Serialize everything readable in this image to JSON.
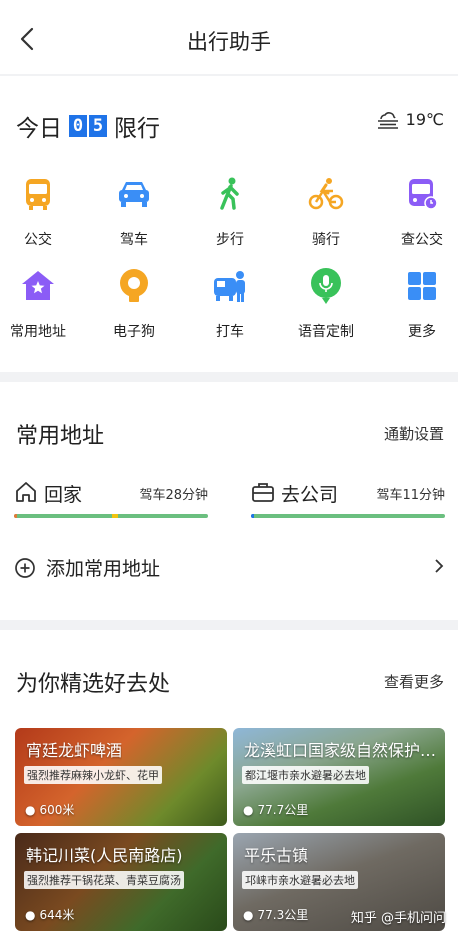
{
  "header": {
    "title": "出行助手"
  },
  "restriction": {
    "label_prefix": "今日",
    "digit1": "0",
    "digit2": "5",
    "label_suffix": "限行"
  },
  "weather": {
    "temp": "19℃",
    "icon": "cloud-fog-icon"
  },
  "grid": {
    "items": [
      {
        "label": "公交",
        "icon": "bus-icon",
        "color": "#f5a623"
      },
      {
        "label": "驾车",
        "icon": "car-icon",
        "color": "#3a8ef6"
      },
      {
        "label": "步行",
        "icon": "walk-icon",
        "color": "#39c25a"
      },
      {
        "label": "骑行",
        "icon": "bike-icon",
        "color": "#f5a623"
      },
      {
        "label": "查公交",
        "icon": "bus-search-icon",
        "color": "#8b5cf6"
      },
      {
        "label": "常用地址",
        "icon": "home-star-icon",
        "color": "#8b5cf6"
      },
      {
        "label": "电子狗",
        "icon": "edog-icon",
        "color": "#f5a623"
      },
      {
        "label": "打车",
        "icon": "taxi-icon",
        "color": "#3a8ef6"
      },
      {
        "label": "语音定制",
        "icon": "mic-icon",
        "color": "#39c25a"
      },
      {
        "label": "更多",
        "icon": "more-grid-icon",
        "color": "#3a8ef6"
      }
    ]
  },
  "addresses": {
    "title": "常用地址",
    "link": "通勤设置",
    "home": {
      "name": "回家",
      "duration": "驾车28分钟"
    },
    "work": {
      "name": "去公司",
      "duration": "驾车11分钟"
    },
    "add_label": "添加常用地址"
  },
  "recommend": {
    "title": "为你精选好去处",
    "link": "查看更多",
    "places": [
      {
        "name": "宵廷龙虾啤酒",
        "tag": "强烈推荐麻辣小龙虾、花甲",
        "distance": "600米"
      },
      {
        "name": "龙溪虹口国家级自然保护…",
        "tag": "都江堰市亲水避暑必去地",
        "distance": "77.7公里"
      },
      {
        "name": "韩记川菜(人民南路店)",
        "tag": "强烈推荐干锅花菜、青菜豆腐汤",
        "distance": "644米"
      },
      {
        "name": "平乐古镇",
        "tag": "邛崃市亲水避暑必去地",
        "distance": "77.3公里"
      }
    ],
    "watermark": "知乎 @手机问问"
  },
  "colors": {
    "accent": "#1f73e8",
    "route_green": "#6bbf7f"
  }
}
